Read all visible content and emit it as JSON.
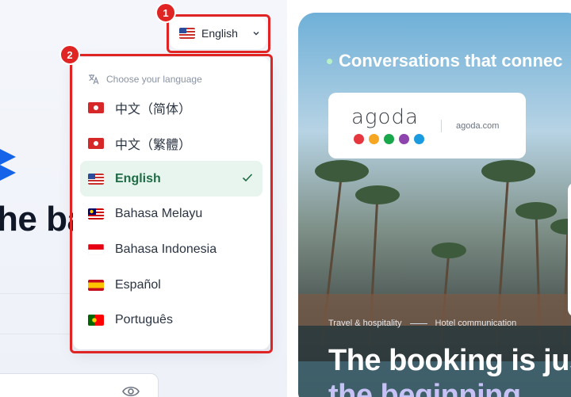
{
  "language_button": {
    "label": "English",
    "flag": "us-flag-icon",
    "chevron": "chevron-down-icon"
  },
  "dropdown": {
    "header": "Choose your language",
    "header_icon": "translate-icon",
    "items": [
      {
        "label": "中文（简体）",
        "flag": "hk-flag-icon",
        "selected": false
      },
      {
        "label": "中文（繁體）",
        "flag": "hk-flag-icon",
        "selected": false
      },
      {
        "label": "English",
        "flag": "us-flag-icon",
        "selected": true
      },
      {
        "label": "Bahasa Melayu",
        "flag": "my-flag-icon",
        "selected": false
      },
      {
        "label": "Bahasa Indonesia",
        "flag": "id-flag-icon",
        "selected": false
      },
      {
        "label": "Español",
        "flag": "es-flag-icon",
        "selected": false
      },
      {
        "label": "Português",
        "flag": "pt-flag-icon",
        "selected": false
      }
    ]
  },
  "annotations": {
    "badge_1": "1",
    "badge_2": "2"
  },
  "left": {
    "hero_fragment": "he ba"
  },
  "right": {
    "tagline": "Conversations that connec",
    "card": {
      "brand": "agoda",
      "url": "agoda.com",
      "dot_colors": [
        "#e6373f",
        "#f5a623",
        "#1aa64a",
        "#8e44ad",
        "#1a9be0"
      ]
    },
    "meta_tag_1": "Travel & hospitality",
    "meta_tag_2": "Hotel communication",
    "headline_1": "The booking is jus",
    "headline_2": "the beginning"
  },
  "colors": {
    "highlight": "#e02424",
    "selected_bg": "#e8f5ee",
    "selected_text": "#1f6b46",
    "brand_blue": "#1463e8"
  }
}
